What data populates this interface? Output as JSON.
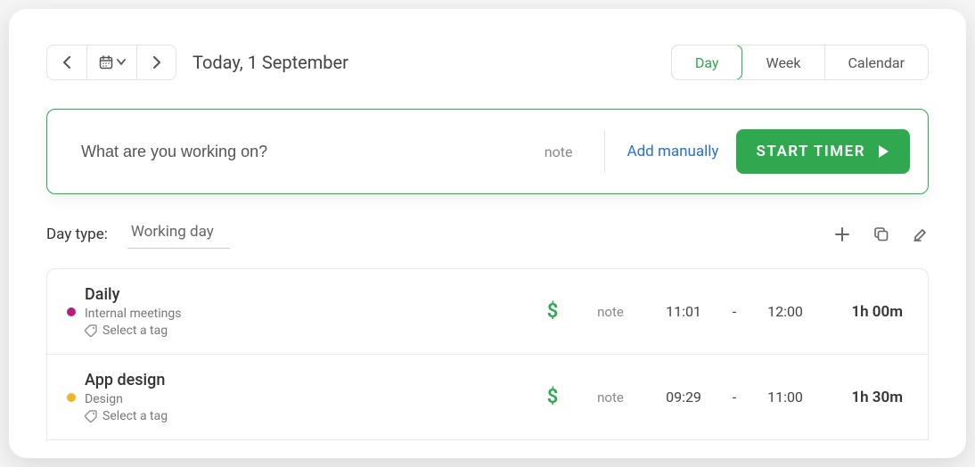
{
  "header": {
    "date_label": "Today, 1 September",
    "tabs": [
      "Day",
      "Week",
      "Calendar"
    ],
    "active_tab": 0
  },
  "timer": {
    "placeholder": "What are you working on?",
    "note_label": "note",
    "add_manually_label": "Add manually",
    "start_label": "START TIMER"
  },
  "daytype": {
    "label": "Day type:",
    "value": "Working day"
  },
  "entries": [
    {
      "color": "#b51f7a",
      "title": "Daily",
      "category": "Internal meetings",
      "tag_label": "Select a tag",
      "billable": "$",
      "note": "note",
      "start": "11:01",
      "end": "12:00",
      "duration": "1h 00m"
    },
    {
      "color": "#f0b429",
      "title": "App design",
      "category": "Design",
      "tag_label": "Select a tag",
      "billable": "$",
      "note": "note",
      "start": "09:29",
      "end": "11:00",
      "duration": "1h 30m"
    }
  ]
}
